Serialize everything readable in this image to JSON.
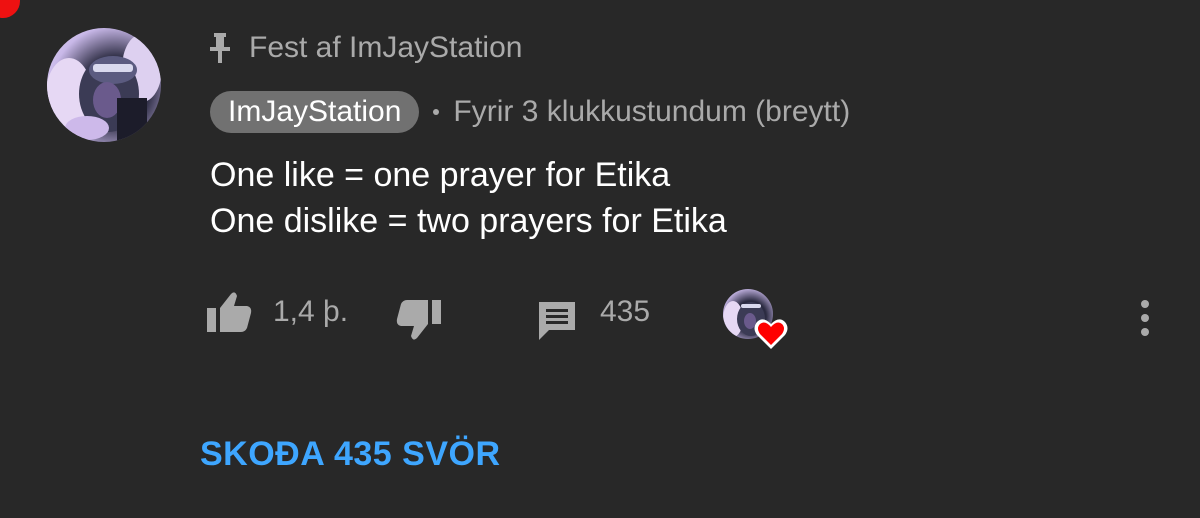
{
  "pinned": {
    "label": "Fest af ImJayStation",
    "icon": "pin-icon"
  },
  "comment": {
    "author": "ImJayStation",
    "timestamp": "Fyrir 3 klukkustundum (breytt)",
    "lines": [
      "One like = one prayer for Etika",
      "One dislike = two prayers for Etika"
    ]
  },
  "actions": {
    "like_count": "1,4 þ.",
    "reply_count": "435",
    "like_icon": "thumb-up-icon",
    "dislike_icon": "thumb-down-icon",
    "reply_icon": "comment-icon",
    "more_icon": "more-vert-icon",
    "heart_icon": "heart-icon"
  },
  "replies": {
    "view_label": "SKOÐA 435 SVÖR"
  },
  "colors": {
    "background": "#282828",
    "author_chip": "#717171",
    "link": "#3ea6ff",
    "heart": "#ff0000",
    "secondary_text": "#aaaaaa"
  }
}
